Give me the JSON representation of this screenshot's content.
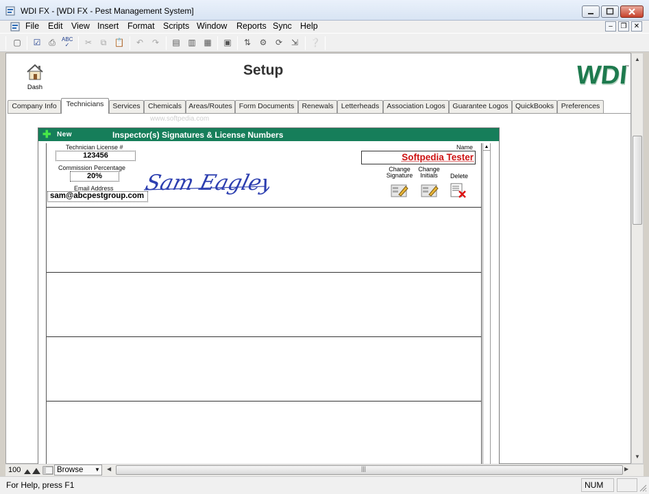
{
  "window": {
    "title": "WDI FX - [WDI FX - Pest Management System]",
    "controls": [
      "minimize",
      "maximize",
      "close"
    ]
  },
  "menu": [
    "File",
    "Edit",
    "View",
    "Insert",
    "Format",
    "Scripts",
    "Window",
    "Reports",
    "Sync",
    "Help"
  ],
  "toolbar_icons": [
    "new-icon",
    "check-icon",
    "print-icon",
    "spell-check-icon",
    "cut-icon",
    "copy-icon",
    "paste-icon",
    "undo-icon",
    "redo-icon",
    "new-record-icon",
    "duplicate-record-icon",
    "delete-record-icon",
    "find-icon",
    "sort-icon",
    "script-icon",
    "sync-icon",
    "import-icon",
    "export-icon",
    "help-icon"
  ],
  "page": {
    "dash_label": "Dash",
    "title": "Setup",
    "logo_text": "WDI",
    "logo_color": "#1e7a4e"
  },
  "tabs": [
    "Company Info",
    "Technicians",
    "Services",
    "Chemicals",
    "Areas/Routes",
    "Form Documents",
    "Renewals",
    "Letterheads",
    "Association Logos",
    "Guarantee Logos",
    "QuickBooks",
    "Preferences"
  ],
  "active_tab": "Technicians",
  "panel": {
    "new_label": "New",
    "title": "Inspector(s) Signatures & License Numbers",
    "header_color": "#167e5a"
  },
  "technician": {
    "license_label": "Technician License #",
    "license_value": "123456",
    "commission_label": "Commission Percentage",
    "commission_value": "20%",
    "email_label": "Email Address",
    "email_value": "sam@abcpestgroup.com",
    "name_label": "Name",
    "name_value": "Softpedia Tester",
    "signature_text": "Sam Eagleye",
    "actions": {
      "change_signature": [
        "Change",
        "Signature"
      ],
      "change_initials": [
        "Change",
        "Initials"
      ],
      "delete": "Delete"
    }
  },
  "watermark": "www.softpedia.com",
  "bottom_bar": {
    "zoom": "100",
    "mode": "Browse"
  },
  "status": {
    "help_text": "For Help, press F1",
    "num_indicator": "NUM"
  }
}
